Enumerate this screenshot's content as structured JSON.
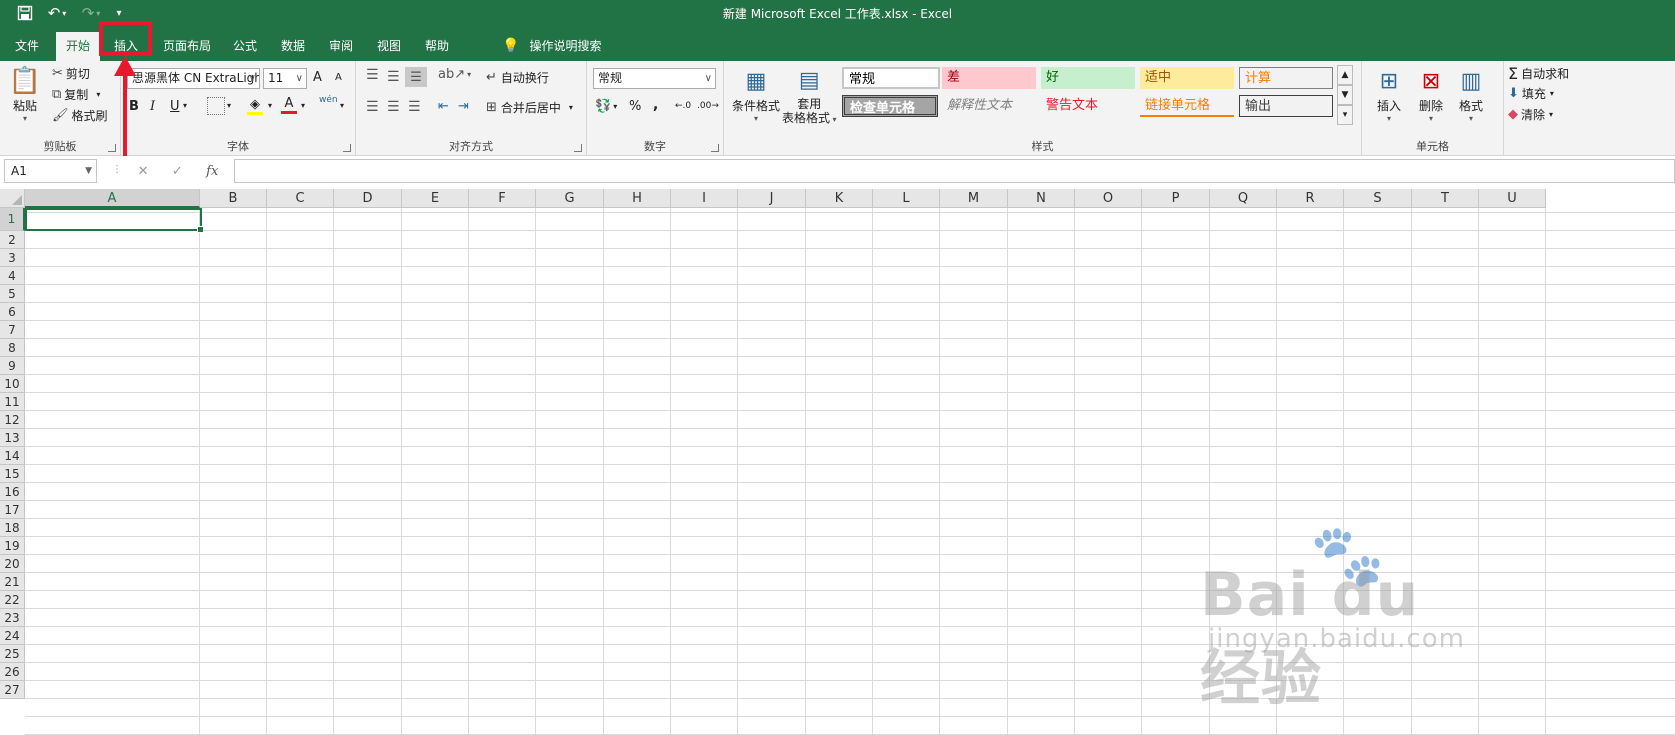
{
  "window": {
    "title": "新建 Microsoft Excel 工作表.xlsx  -  Excel"
  },
  "qat": {
    "save_icon": "save-icon",
    "undo_icon": "undo-icon",
    "redo_icon": "redo-icon",
    "customize_icon": "customize-qat-icon"
  },
  "tabs": [
    {
      "label": "文件"
    },
    {
      "label": "开始"
    },
    {
      "label": "插入"
    },
    {
      "label": "页面布局"
    },
    {
      "label": "公式"
    },
    {
      "label": "数据"
    },
    {
      "label": "审阅"
    },
    {
      "label": "视图"
    },
    {
      "label": "帮助"
    }
  ],
  "tell_me": {
    "label": "操作说明搜索"
  },
  "clipboard": {
    "paste": "粘贴",
    "cut": "剪切",
    "copy": "复制",
    "format_painter": "格式刷",
    "group": "剪贴板"
  },
  "font": {
    "name": "思源黑体 CN ExtraLight",
    "size": "11",
    "bold": "B",
    "italic": "I",
    "underline": "U",
    "grow": "A",
    "shrink": "A",
    "font_color": "A",
    "phonetic": "wén",
    "group": "字体"
  },
  "alignment": {
    "wrap": "自动换行",
    "merge": "合并后居中",
    "group": "对齐方式"
  },
  "number": {
    "format": "常规",
    "percent": "%",
    "comma": ",",
    "group": "数字"
  },
  "styles": {
    "conditional": "条件格式",
    "table1": "套用",
    "table2": "表格格式",
    "normal": "常规",
    "bad": "差",
    "good": "好",
    "neutral": "适中",
    "calculation": "计算",
    "check_cell": "检查单元格",
    "explanatory": "解释性文本",
    "warning": "警告文本",
    "linked_cell": "链接单元格",
    "output": "输出",
    "group": "样式"
  },
  "cells": {
    "insert": "插入",
    "delete": "删除",
    "format": "格式",
    "group": "单元格"
  },
  "editing": {
    "autosum": "自动求和",
    "fill": "填充",
    "clear": "清除"
  },
  "formula_bar": {
    "name_box": "A1",
    "cancel": "✕",
    "enter": "✓",
    "fx": "fx",
    "value": ""
  },
  "columns": [
    "A",
    "B",
    "C",
    "D",
    "E",
    "F",
    "G",
    "H",
    "I",
    "J",
    "K",
    "L",
    "M",
    "N",
    "O",
    "P",
    "Q",
    "R",
    "S",
    "T",
    "U"
  ],
  "rows": [
    "1",
    "2",
    "3",
    "4",
    "5",
    "6",
    "7",
    "8",
    "9",
    "10",
    "11",
    "12",
    "13",
    "14",
    "15",
    "16",
    "17",
    "18",
    "19",
    "20",
    "21",
    "22",
    "23",
    "24",
    "25",
    "26",
    "27"
  ],
  "watermark": {
    "brand": "Bai du 经验",
    "url": "jingyan.baidu.com"
  },
  "colors": {
    "accent": "#217346",
    "highlight": "#e8192c"
  }
}
